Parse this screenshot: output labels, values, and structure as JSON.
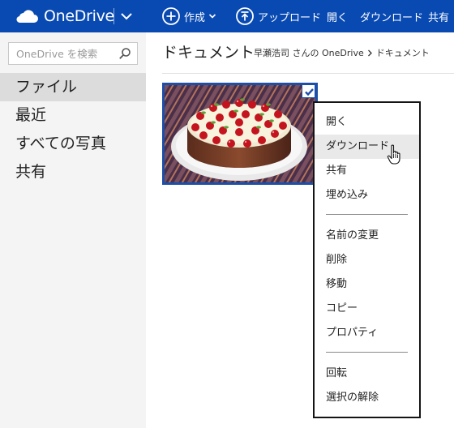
{
  "header": {
    "app_name": "OneDrive",
    "commands": [
      {
        "id": "create",
        "label": "作成",
        "icon": "plus-circle-icon",
        "has_dropdown": true
      },
      {
        "id": "upload",
        "label": "アップロード",
        "icon": "upload-circle-icon",
        "has_dropdown": false
      },
      {
        "id": "open",
        "label": "開く"
      },
      {
        "id": "download",
        "label": "ダウンロード"
      },
      {
        "id": "share",
        "label": "共有"
      }
    ],
    "bar_color": "#094ab2"
  },
  "sidebar": {
    "search_placeholder": "OneDrive を検索",
    "items": [
      {
        "label": "ファイル",
        "active": true
      },
      {
        "label": "最近",
        "active": false
      },
      {
        "label": "すべての写真",
        "active": false
      },
      {
        "label": "共有",
        "active": false
      }
    ]
  },
  "main": {
    "title": "ドキュメント",
    "breadcrumb": [
      "早瀬浩司 さんの OneDrive",
      "ドキュメント"
    ],
    "tile": {
      "content": "strawberry-cake-photo",
      "selected": true
    }
  },
  "context_menu": {
    "groups": [
      [
        "開く",
        "ダウンロード",
        "共有",
        "埋め込み"
      ],
      [
        "名前の変更",
        "削除",
        "移動",
        "コピー",
        "プロパティ"
      ],
      [
        "回転",
        "選択の解除"
      ]
    ],
    "hovered": "ダウンロード"
  }
}
